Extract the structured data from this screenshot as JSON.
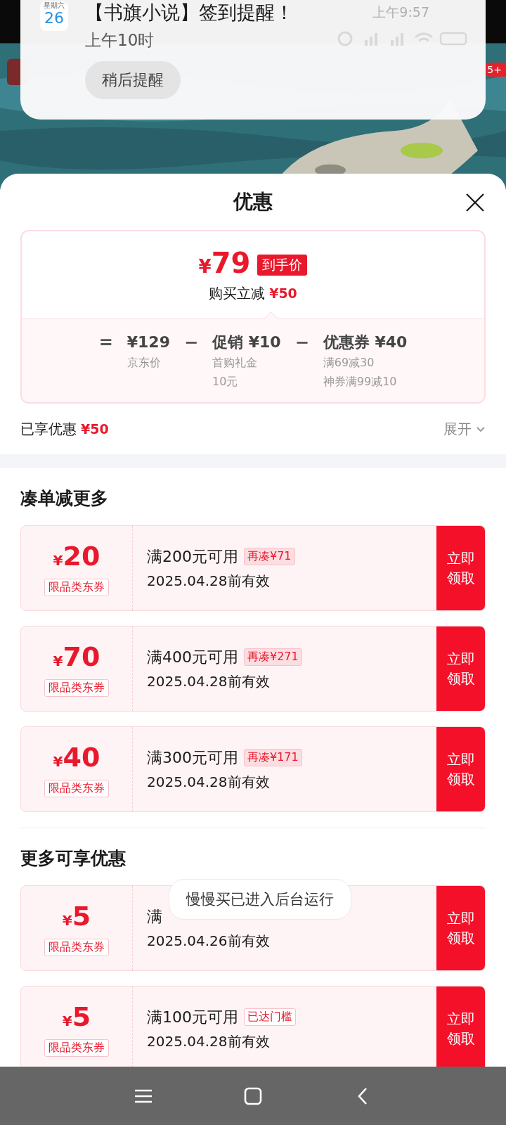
{
  "notification": {
    "calendar_weekday": "星期六",
    "calendar_day": "26",
    "title": "【书旗小说】签到提醒！",
    "time": "上午9:57",
    "subtitle": "上午10时",
    "action": "稍后提醒"
  },
  "background_badge": "5+",
  "sheet": {
    "title": "优惠"
  },
  "summary": {
    "price_symbol": "¥",
    "price": "79",
    "price_tag": "到手价",
    "reduction_label": "购买立减",
    "reduction": "¥50"
  },
  "breakdown": [
    {
      "kind": "operator",
      "text": "="
    },
    {
      "kind": "term",
      "amount": "¥129",
      "notes": [
        "京东价"
      ]
    },
    {
      "kind": "operator",
      "text": "−"
    },
    {
      "kind": "term",
      "amount": "促销 ¥10",
      "notes": [
        "首购礼金",
        "10元"
      ]
    },
    {
      "kind": "operator",
      "text": "−"
    },
    {
      "kind": "term",
      "amount": "优惠券 ¥40",
      "notes": [
        "满69减30",
        "神券满99减10"
      ]
    }
  ],
  "enjoyed": {
    "label": "已享优惠",
    "amount": "¥50",
    "toggle": "展开",
    "expanded": false
  },
  "sections": [
    {
      "title": "凑单减更多",
      "coupons": [
        {
          "symbol": "¥",
          "amount": "20",
          "scope": "限品类东券",
          "condition": "满200元可用",
          "tag": {
            "kind": "shortfall",
            "text": "再凑¥71"
          },
          "validity": "2025.04.28前有效",
          "button": "立即领取"
        },
        {
          "symbol": "¥",
          "amount": "70",
          "scope": "限品类东券",
          "condition": "满400元可用",
          "tag": {
            "kind": "shortfall",
            "text": "再凑¥271"
          },
          "validity": "2025.04.28前有效",
          "button": "立即领取"
        },
        {
          "symbol": "¥",
          "amount": "40",
          "scope": "限品类东券",
          "condition": "满300元可用",
          "tag": {
            "kind": "shortfall",
            "text": "再凑¥171"
          },
          "validity": "2025.04.28前有效",
          "button": "立即领取"
        }
      ]
    },
    {
      "title": "更多可享优惠",
      "coupons": [
        {
          "symbol": "¥",
          "amount": "5",
          "scope": "限品类东券",
          "condition": "满",
          "validity": "2025.04.26前有效",
          "button": "立即领取"
        },
        {
          "symbol": "¥",
          "amount": "5",
          "scope": "限品类东券",
          "condition": "满100元可用",
          "tag": {
            "kind": "reached",
            "text": "已达门槛"
          },
          "validity": "2025.04.28前有效",
          "button": "立即领取"
        }
      ]
    }
  ],
  "toast": "慢慢买已进入后台运行"
}
